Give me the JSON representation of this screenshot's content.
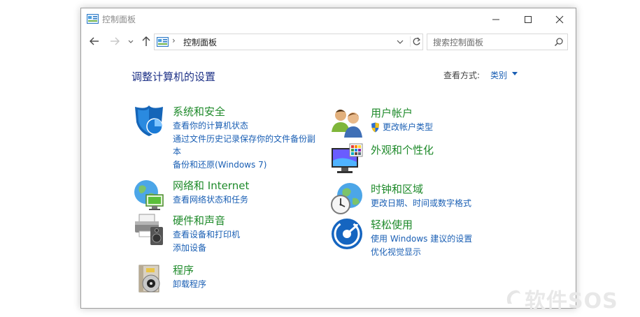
{
  "window": {
    "title": "控制面板"
  },
  "nav": {
    "address_sep": "›",
    "address_text": "控制面板",
    "search_placeholder": "搜索控制面板"
  },
  "main": {
    "heading": "调整计算机的设置",
    "view_by_label": "查看方式:",
    "view_by_value": "类别"
  },
  "categories": {
    "system": {
      "title": "系统和安全",
      "links": [
        "查看你的计算机状态",
        "通过文件历史记录保存你的文件备份副",
        "本",
        "备份和还原(Windows 7)"
      ]
    },
    "network": {
      "title": "网络和 Internet",
      "links": [
        "查看网络状态和任务"
      ]
    },
    "hardware": {
      "title": "硬件和声音",
      "links": [
        "查看设备和打印机",
        "添加设备"
      ]
    },
    "programs": {
      "title": "程序",
      "links": [
        "卸载程序"
      ]
    },
    "user": {
      "title": "用户帐户",
      "links": [
        "更改帐户类型"
      ]
    },
    "appearance": {
      "title": "外观和个性化",
      "links": []
    },
    "clock": {
      "title": "时钟和区域",
      "links": [
        "更改日期、时间或数字格式"
      ]
    },
    "ease": {
      "title": "轻松使用",
      "links": [
        "使用 Windows 建议的设置",
        "优化视觉显示"
      ]
    }
  },
  "watermark": {
    "text": "软件SOS"
  }
}
